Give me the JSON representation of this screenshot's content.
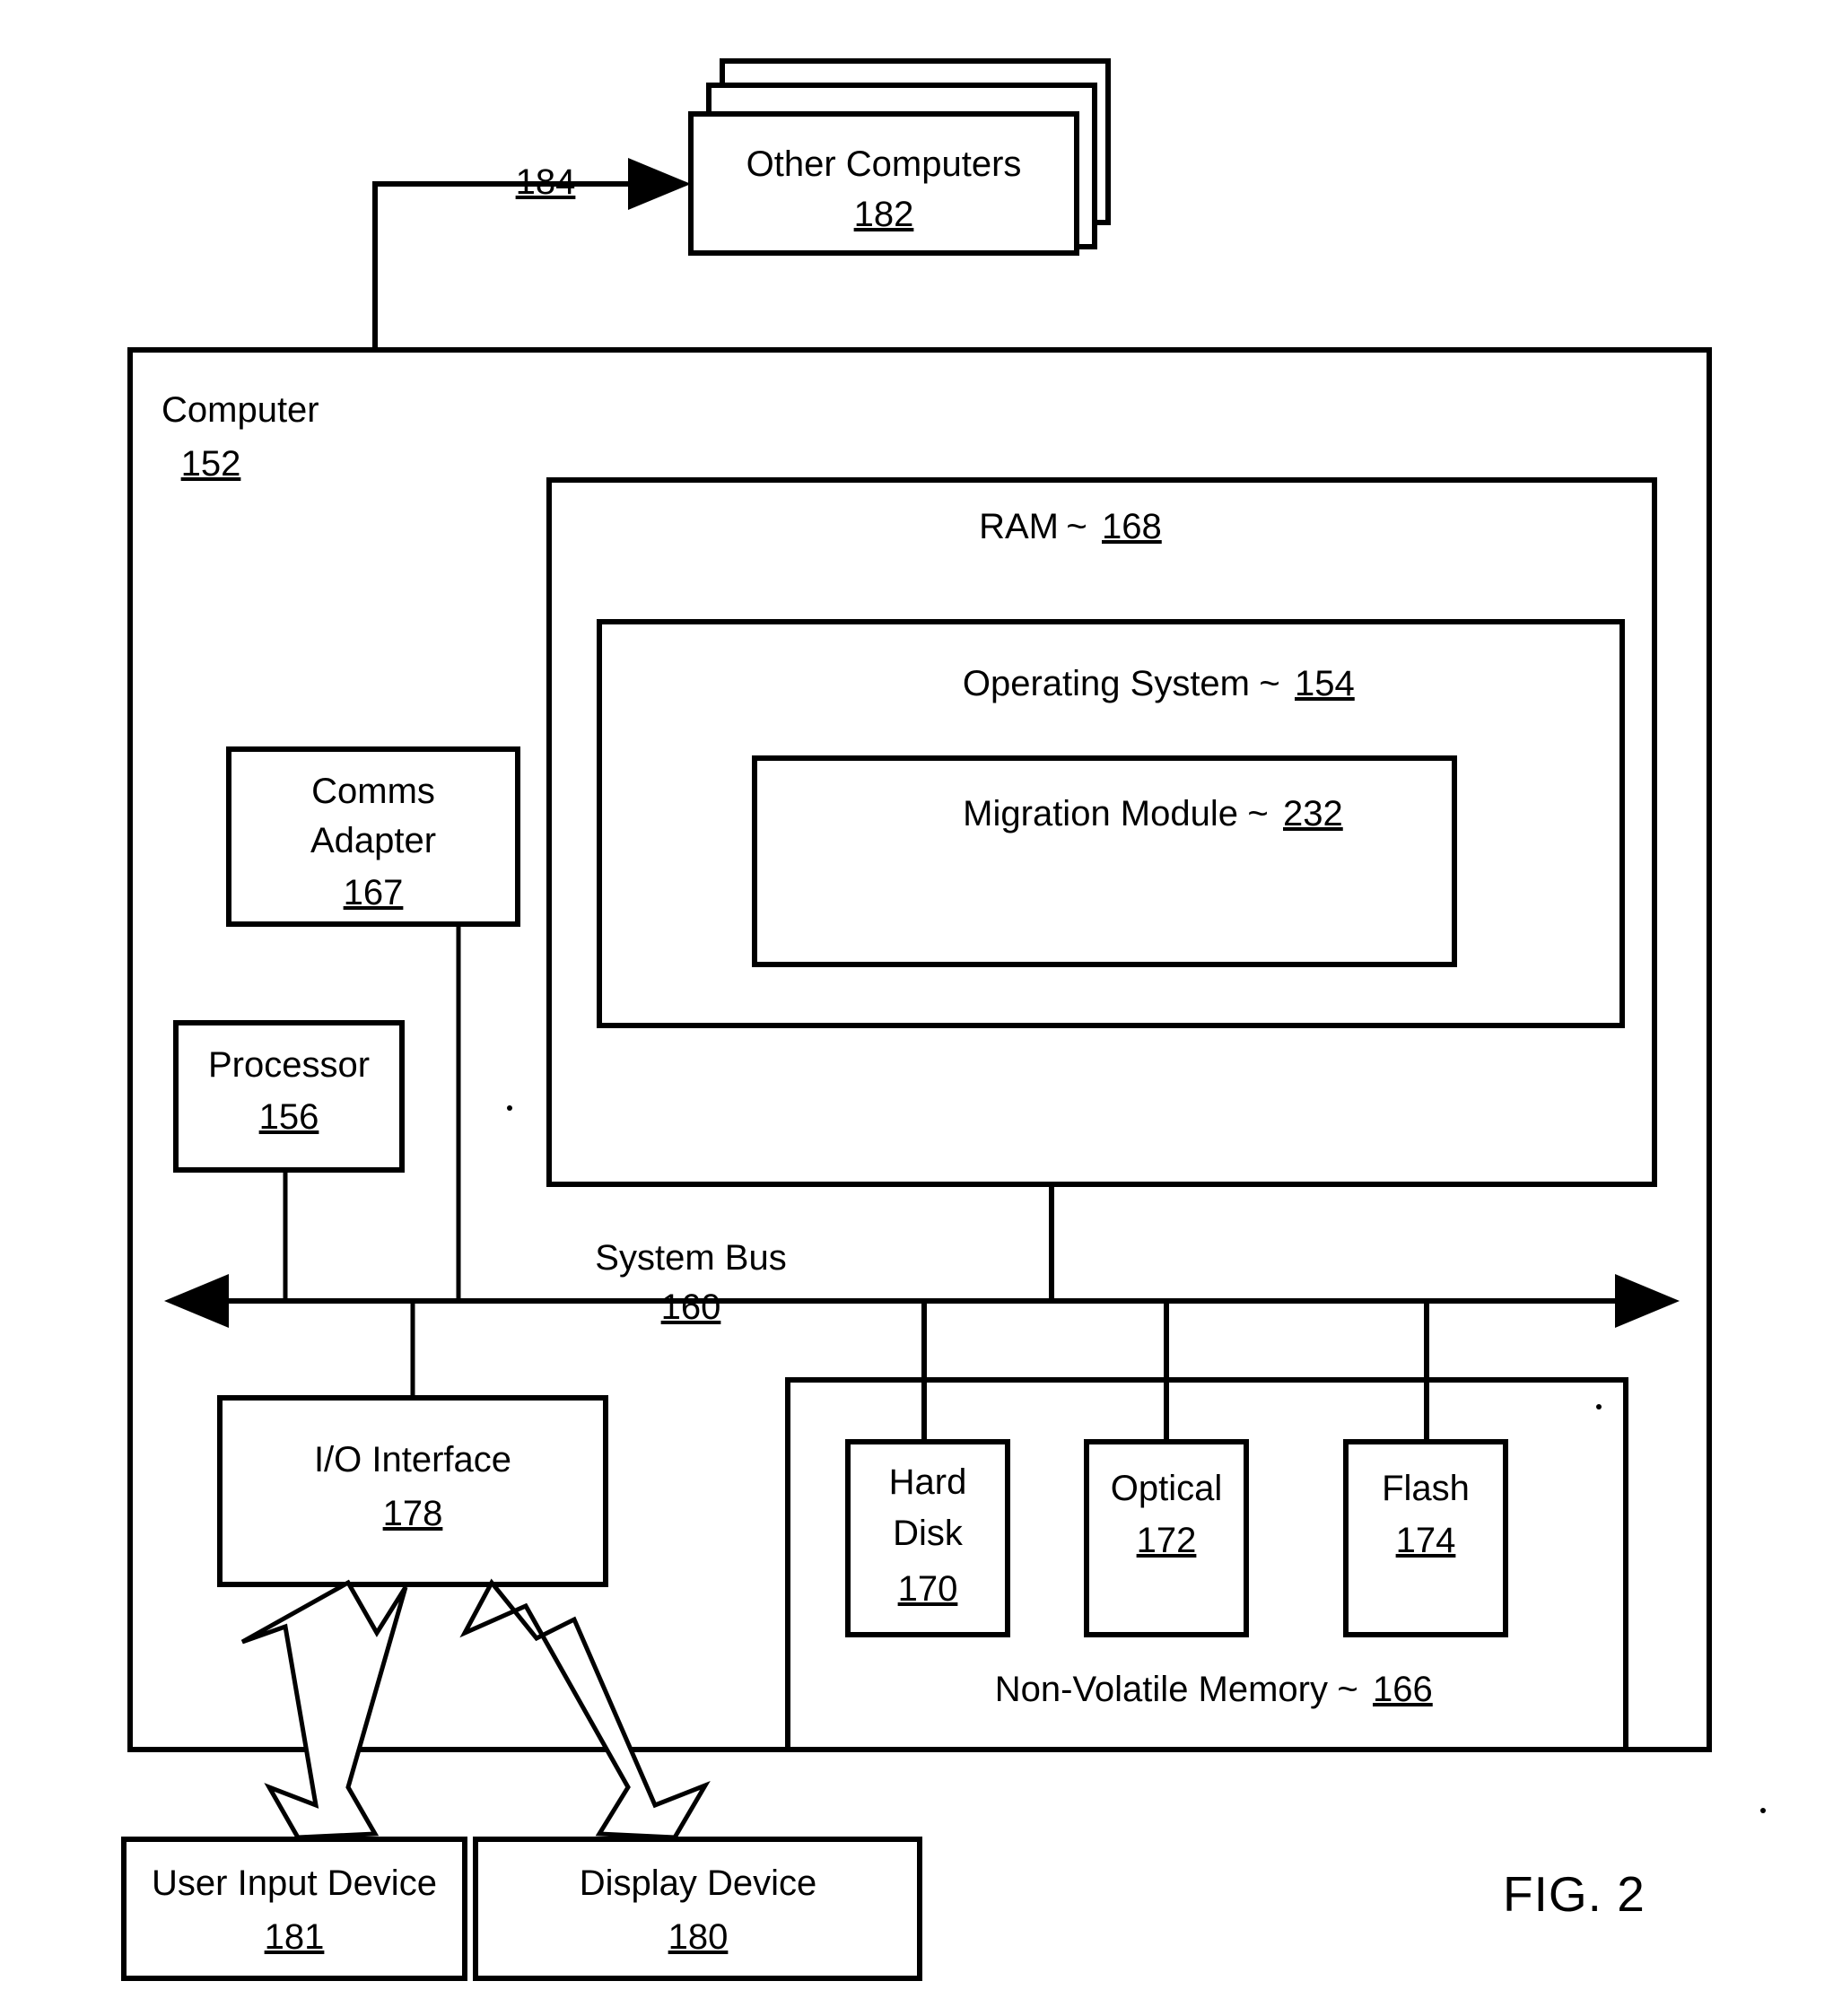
{
  "figure": {
    "caption": "FIG. 2",
    "tilde": "~"
  },
  "nodes": {
    "other_computers": {
      "label": "Other Computers",
      "ref": "182"
    },
    "link_184": {
      "ref": "184"
    },
    "computer": {
      "label": "Computer",
      "ref": "152"
    },
    "ram": {
      "label": "RAM",
      "ref": "168"
    },
    "operating_system": {
      "label": "Operating System",
      "ref": "154"
    },
    "migration_module": {
      "label": "Migration Module",
      "ref": "232"
    },
    "comms_adapter": {
      "label_line1": "Comms",
      "label_line2": "Adapter",
      "ref": "167"
    },
    "processor": {
      "label": "Processor",
      "ref": "156"
    },
    "system_bus": {
      "label": "System Bus",
      "ref": "160"
    },
    "io_interface": {
      "label": "I/O Interface",
      "ref": "178"
    },
    "non_volatile_memory": {
      "label": "Non-Volatile Memory",
      "ref": "166"
    },
    "hard_disk": {
      "label_line1": "Hard",
      "label_line2": "Disk",
      "ref": "170"
    },
    "optical": {
      "label": "Optical",
      "ref": "172"
    },
    "flash": {
      "label": "Flash",
      "ref": "174"
    },
    "user_input_device": {
      "label": "User Input Device",
      "ref": "181"
    },
    "display_device": {
      "label": "Display Device",
      "ref": "180"
    }
  },
  "colors": {
    "stroke": "#000000",
    "fill": "#ffffff"
  }
}
